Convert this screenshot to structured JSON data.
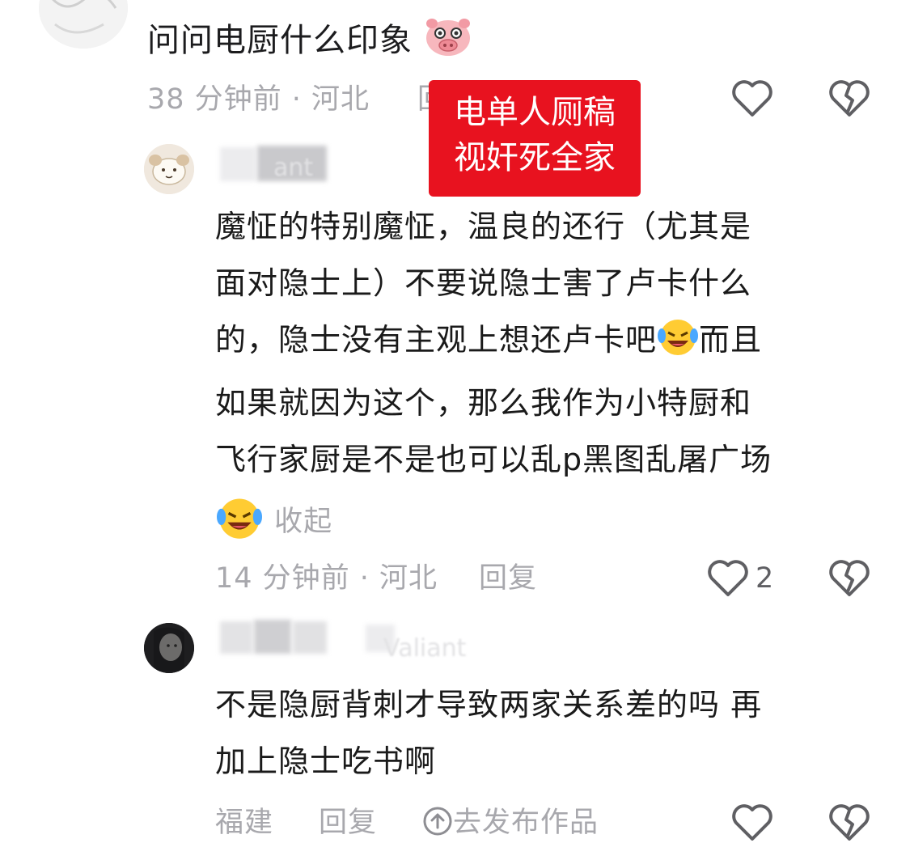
{
  "top_comment": {
    "text": "问问电厨什么印象",
    "emoji": "pig-face-emoji",
    "meta": "38 分钟前 · 河北",
    "reply_partial": "回"
  },
  "overlay_badge": {
    "line1": "电单人厕稿",
    "line2": "视奸死全家",
    "color": "#e8121f"
  },
  "reply1": {
    "username_ghost": "ant",
    "lines": [
      "魔怔的特别魔怔，温良的还行（尤其是",
      "面对隐士上）不要说隐士害了卢卡什么",
      "的，隐士没有主观上想还卢卡吧",
      "而且",
      "如果就因为这个，那么我作为小特厨和",
      "飞行家厨是不是也可以乱p黑图乱屠广场"
    ],
    "collapse_label": "收起",
    "meta": "14 分钟前 · 河北",
    "reply_label": "回复",
    "like_count": "2"
  },
  "reply2": {
    "username_ghost": "Valiant",
    "lines": [
      "不是隐厨背刺才导致两家关系差的吗 再",
      "加上隐士吃书啊"
    ],
    "meta": "福建",
    "reply_label": "回复",
    "publish_label": "去发布作品"
  },
  "colors": {
    "meta_gray": "#a8a8ad",
    "icon_gray": "#5f5f63",
    "badge_red": "#e8121f"
  }
}
